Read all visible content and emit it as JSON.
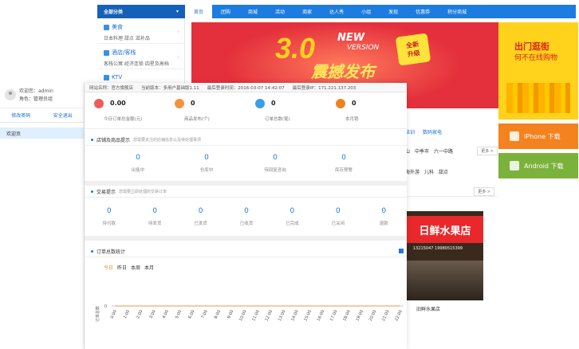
{
  "site": {
    "category_all": "全部分类",
    "nav": [
      "首页",
      "团购",
      "商城",
      "活动",
      "商家",
      "达人秀",
      "小组",
      "发现",
      "优惠券",
      "积分商城"
    ],
    "categories": [
      {
        "title": "美食",
        "sub": "日本料理  甜点  滋补品"
      },
      {
        "title": "酒店/客栈",
        "sub": "客栈公寓  经济连锁  四星及高档"
      },
      {
        "title": "KTV",
        "sub": ""
      }
    ],
    "banner": {
      "big": "3.0",
      "new": "NEW",
      "version": "VERSION",
      "title": "震撼发布",
      "badge1": "全新",
      "badge2": "升级"
    },
    "promo": {
      "line1": "出门逛街",
      "line2": "何不在线购物"
    },
    "download": {
      "iphone": "IPhone 下载",
      "android": "Android 下载"
    },
    "mid": {
      "tabs": [
        "培训",
        "数码家电"
      ],
      "row1": [
        "山",
        "中季市",
        "六一中路"
      ],
      "row2": [
        "海外游",
        "儿科",
        "甜点"
      ],
      "more": "更多 >",
      "more2": "更多 >"
    },
    "shop": {
      "sign": "日鲜水果店",
      "phone": "13215047 19980515399",
      "caption": "旧鲜水果店"
    }
  },
  "admin": {
    "welcome": "欢迎您：admin",
    "role": "角色：管理员组",
    "change_pwd": "修改密码",
    "logout": "安全退出",
    "menu": [
      "欢迎页"
    ],
    "status": [
      "网站名称：官方旗舰店",
      "当前版本：多用户基础版1.11",
      "最后登录时间：2016-03-07 14:42:07",
      "最后登录IP：171.221.137.203"
    ],
    "kpis": [
      {
        "value": "0.00",
        "label": "今日订单总金额(元)",
        "color": "#f25a5a"
      },
      {
        "value": "0",
        "label": "商品发布(个)",
        "color": "#f5923e"
      },
      {
        "value": "0",
        "label": "订单总数(笔)",
        "color": "#3a9ee8"
      },
      {
        "value": "0",
        "label": "本月销",
        "color": "#f0821e"
      }
    ],
    "store_section": {
      "title": "店铺及商品提示",
      "hint": "您需要关注的店铺信息以及待处理事项",
      "items": [
        {
          "value": "0",
          "label": "出售中"
        },
        {
          "value": "0",
          "label": "仓库中"
        },
        {
          "value": "0",
          "label": "待回复咨询"
        },
        {
          "value": "0",
          "label": "库存预警"
        }
      ]
    },
    "trade_section": {
      "title": "交易提示",
      "hint": "您需要立即处理的交易订单",
      "items": [
        {
          "value": "0",
          "label": "待付款"
        },
        {
          "value": "0",
          "label": "待发货"
        },
        {
          "value": "0",
          "label": "已发货"
        },
        {
          "value": "0",
          "label": "已收货"
        },
        {
          "value": "0",
          "label": "已完成"
        },
        {
          "value": "0",
          "label": "已关闭"
        },
        {
          "value": "0",
          "label": "退款"
        }
      ]
    },
    "chart_title": "订单总数统计",
    "ranges": [
      "今日",
      "昨日",
      "本周",
      "本月"
    ]
  },
  "chart_data": {
    "type": "line",
    "ylabel": "订单总数",
    "x": [
      "0:00",
      "1:00",
      "2:00",
      "3:00",
      "4:00",
      "5:00",
      "6:00",
      "7:00",
      "8:00",
      "9:00",
      "10:00",
      "11:00",
      "12:00",
      "13:00",
      "14:00",
      "15:00",
      "16:00",
      "17:00",
      "18:00",
      "19:00",
      "20:00",
      "21:00",
      "22:00"
    ],
    "series": [
      {
        "values": [
          0,
          0,
          0,
          0,
          0,
          0,
          0,
          0,
          0,
          0,
          0,
          0,
          0,
          0,
          0,
          0,
          0,
          0,
          0,
          0,
          0,
          0,
          0
        ]
      }
    ],
    "y_ticks": [
      "0"
    ],
    "colors": {
      "line": "#f08a24",
      "axis": "#999999"
    }
  }
}
